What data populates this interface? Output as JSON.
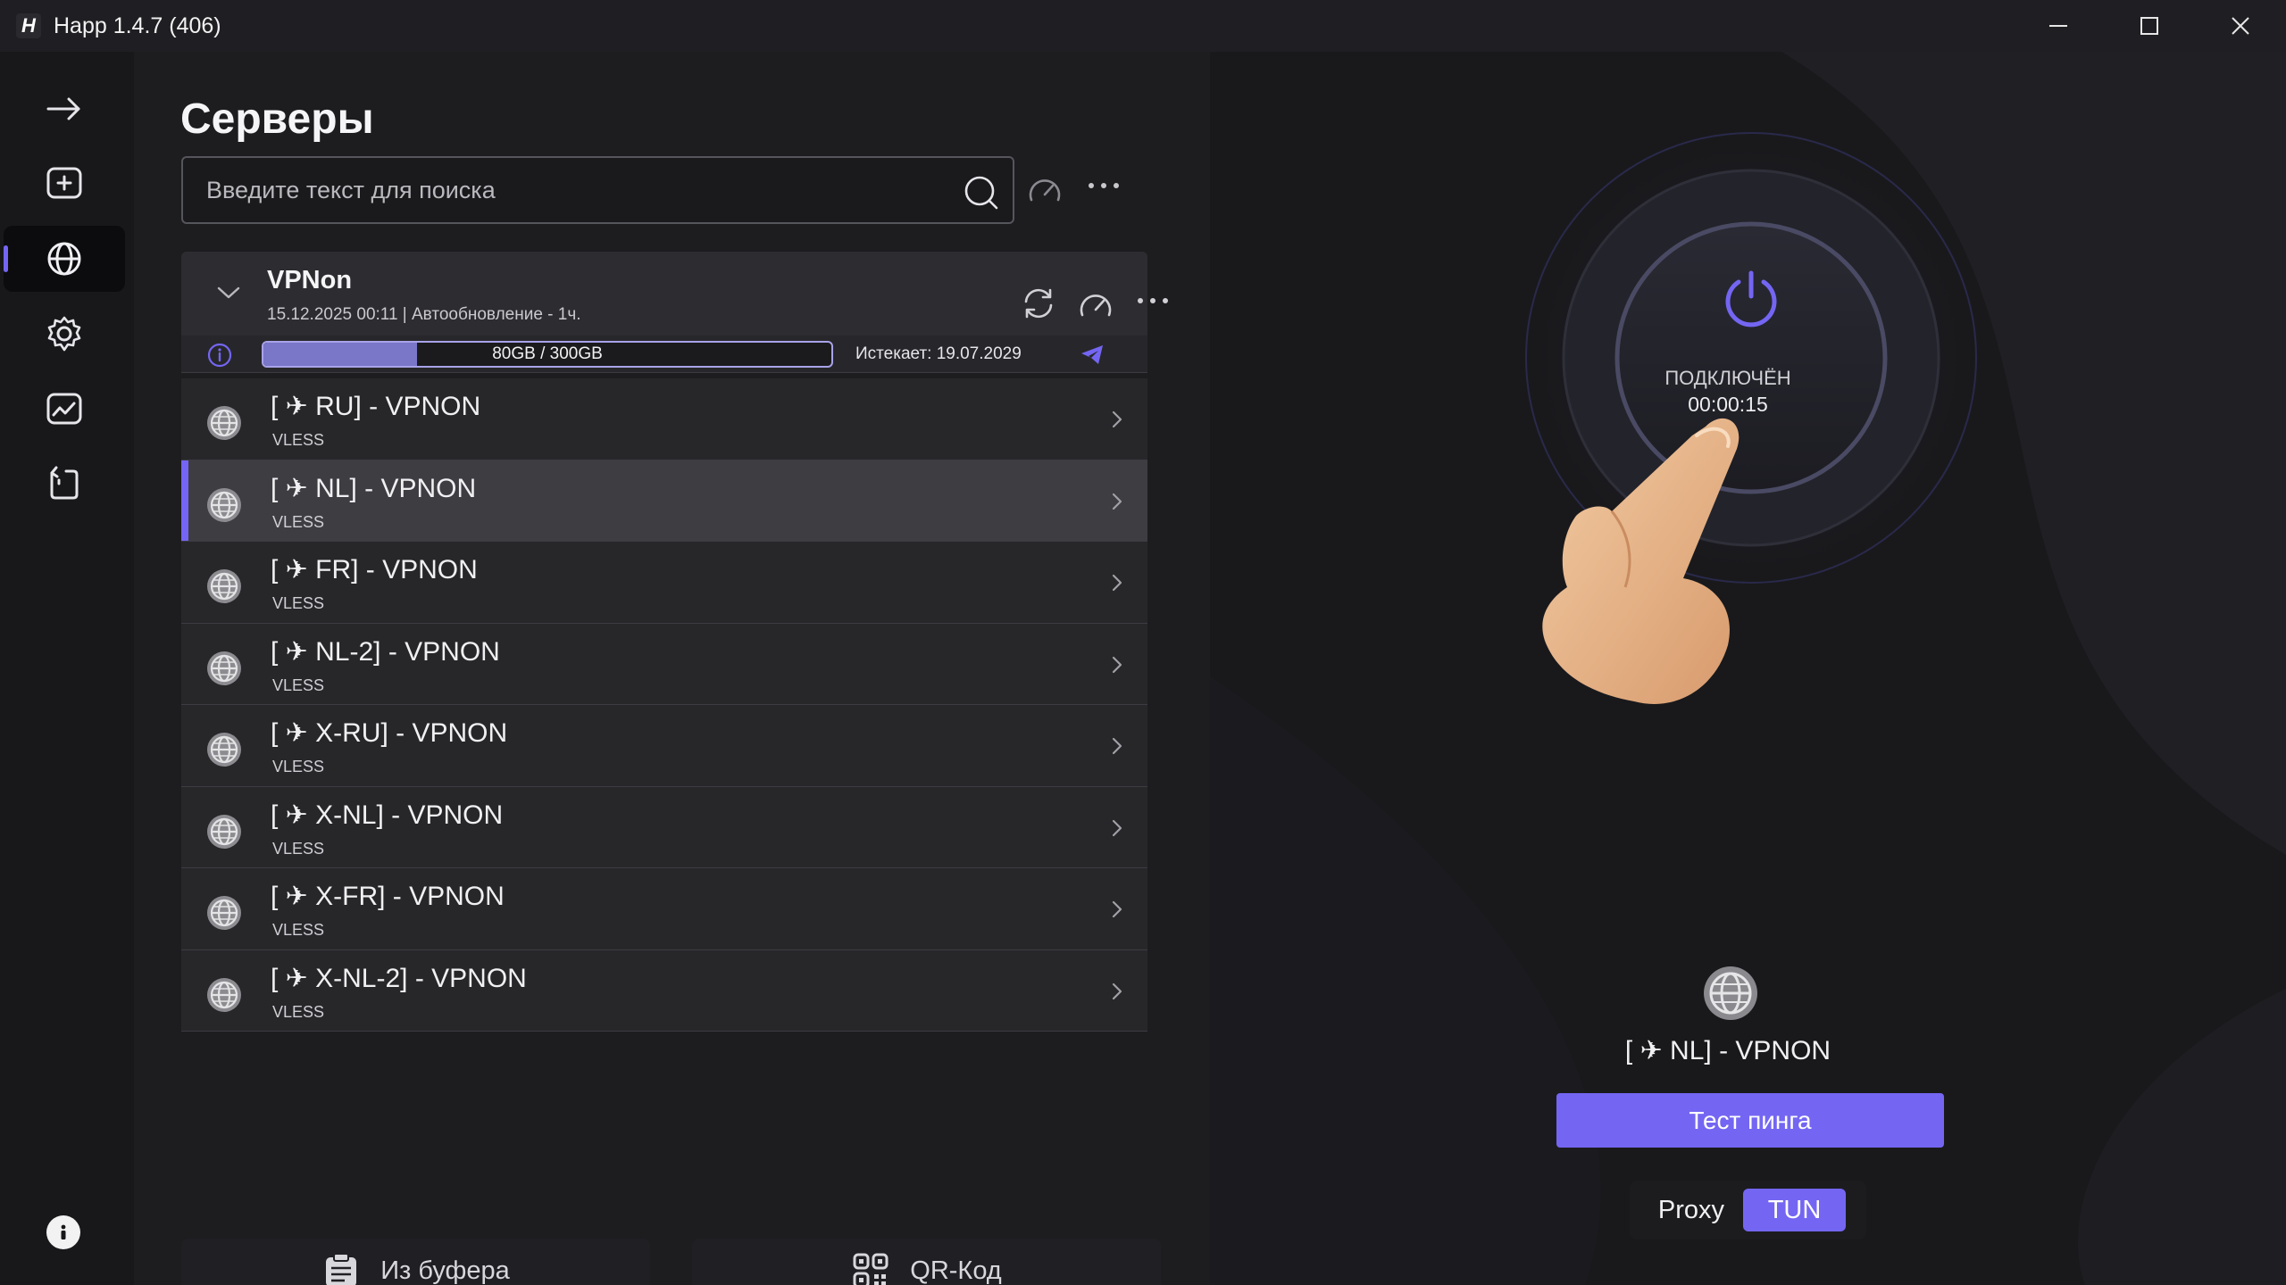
{
  "window": {
    "title": "Happ 1.4.7 (406)",
    "logo_letter": "H"
  },
  "sidebar": {
    "items": [
      {
        "icon": "arrow-right-icon",
        "active": false
      },
      {
        "icon": "add-box-icon",
        "active": false
      },
      {
        "icon": "globe-icon",
        "active": true
      },
      {
        "icon": "gear-icon",
        "active": false
      },
      {
        "icon": "chart-icon",
        "active": false
      },
      {
        "icon": "routing-icon",
        "active": false
      }
    ],
    "info_icon": "info-icon"
  },
  "servers": {
    "title": "Серверы",
    "search": {
      "placeholder": "Введите текст для поиска",
      "value": ""
    },
    "group": {
      "name": "VPNon",
      "meta": "15.12.2025 00:11 | Автообновление - 1ч.",
      "usage_text": "80GB / 300GB",
      "usage_fraction": 0.27,
      "expires": "Истекает: 19.07.2029"
    },
    "items": [
      {
        "name": "[ ✈ RU] - VPNON",
        "protocol": "VLESS",
        "selected": false
      },
      {
        "name": "[ ✈ NL] - VPNON",
        "protocol": "VLESS",
        "selected": true
      },
      {
        "name": "[ ✈ FR] - VPNON",
        "protocol": "VLESS",
        "selected": false
      },
      {
        "name": "[ ✈ NL-2] - VPNON",
        "protocol": "VLESS",
        "selected": false
      },
      {
        "name": "[ ✈ X-RU] - VPNON",
        "protocol": "VLESS",
        "selected": false
      },
      {
        "name": "[ ✈ X-NL] - VPNON",
        "protocol": "VLESS",
        "selected": false
      },
      {
        "name": "[ ✈ X-FR] - VPNON",
        "protocol": "VLESS",
        "selected": false
      },
      {
        "name": "[ ✈ X-NL-2] - VPNON",
        "protocol": "VLESS",
        "selected": false
      }
    ],
    "buttons": {
      "clipboard": "Из буфера",
      "qr": "QR-Код"
    }
  },
  "connection": {
    "status": "ПОДКЛЮЧЁН",
    "timer": "00:00:15",
    "current_server": "[ ✈ NL] - VPNON",
    "ping_button": "Тест пинга",
    "modes": {
      "proxy": "Proxy",
      "tun": "TUN",
      "active": "TUN"
    }
  },
  "colors": {
    "accent": "#7466f2",
    "background": "#1d1d20"
  }
}
